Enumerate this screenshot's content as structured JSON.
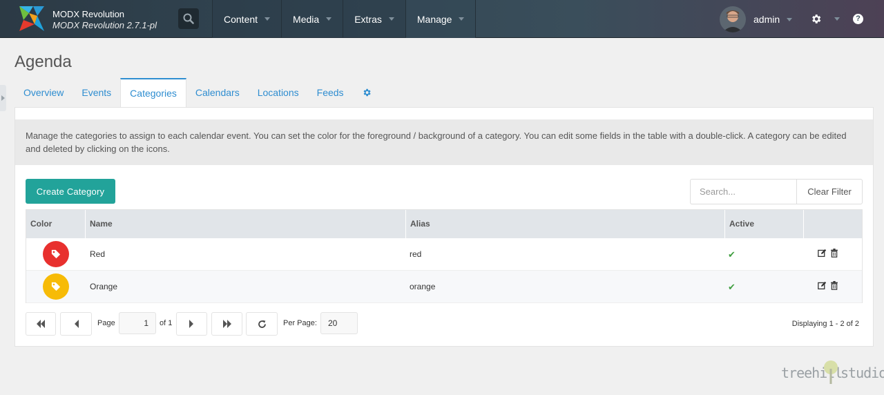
{
  "header": {
    "app_name": "MODX Revolution",
    "app_version": "MODX Revolution 2.7.1-pl",
    "nav": [
      {
        "label": "Content"
      },
      {
        "label": "Media"
      },
      {
        "label": "Extras"
      },
      {
        "label": "Manage"
      }
    ],
    "user_name": "admin",
    "help_glyph": "?"
  },
  "page": {
    "title": "Agenda",
    "tabs": [
      {
        "label": "Overview"
      },
      {
        "label": "Events"
      },
      {
        "label": "Categories",
        "active": true
      },
      {
        "label": "Calendars"
      },
      {
        "label": "Locations"
      },
      {
        "label": "Feeds"
      }
    ],
    "description": "Manage the categories to assign to each calendar event. You can set the color for the foreground / background of a category. You can edit some fields in the table with a double-click. A category can be edited and deleted by clicking on the icons."
  },
  "toolbar": {
    "create_label": "Create Category",
    "search_placeholder": "Search...",
    "clear_filter_label": "Clear Filter"
  },
  "grid": {
    "columns": [
      "Color",
      "Name",
      "Alias",
      "Active",
      ""
    ],
    "rows": [
      {
        "color": "#e8302e",
        "name": "Red",
        "alias": "red",
        "active": true
      },
      {
        "color": "#f7bb07",
        "name": "Orange",
        "alias": "orange",
        "active": true
      }
    ]
  },
  "pager": {
    "page_label": "Page",
    "current_page": "1",
    "of_label": "of 1",
    "per_page_label": "Per Page:",
    "per_page": "20",
    "displaying": "Displaying 1 - 2 of 2"
  },
  "footer": {
    "brand_left": "treehill",
    "brand_right": "studio"
  },
  "colors": {
    "accent": "#2e8dd0",
    "primary_button": "#22a39a",
    "active_check": "#3f9e3f"
  }
}
